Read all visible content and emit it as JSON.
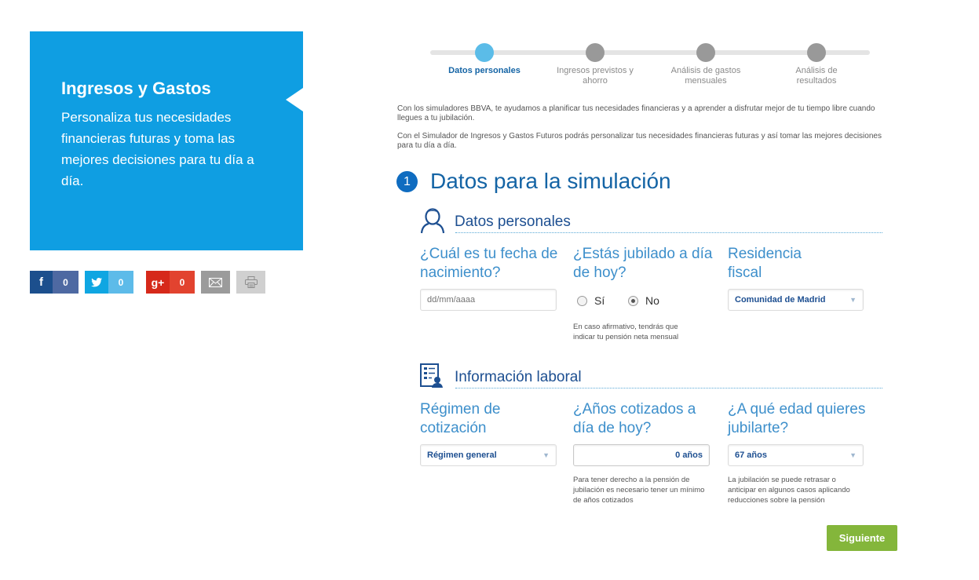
{
  "promo": {
    "title": "Ingresos y Gastos",
    "text": "Personaliza tus necesidades financieras futuras y toma las mejores decisiones para tu día a día."
  },
  "share": {
    "facebook": {
      "icon": "facebook-icon",
      "count": "0",
      "glyph": "f"
    },
    "twitter": {
      "icon": "twitter-icon",
      "count": "0",
      "glyph": "t"
    },
    "googleplus": {
      "icon": "google-plus-icon",
      "count": "0",
      "glyph": "g+"
    },
    "email": {
      "icon": "email-icon"
    },
    "print": {
      "icon": "print-icon"
    }
  },
  "stepper": {
    "current": 1,
    "steps": [
      {
        "label": "Datos personales"
      },
      {
        "label": "Ingresos previstos y ahorro"
      },
      {
        "label": "Análisis de gastos mensuales"
      },
      {
        "label": "Análisis de resultados"
      }
    ]
  },
  "intro": {
    "p1": "Con los simuladores BBVA, te ayudamos a planificar tus necesidades financieras y a aprender a disfrutar mejor de tu tiempo libre cuando llegues a tu jubilación.",
    "p2": "Con el Simulador de Ingresos y Gastos Futuros podrás personalizar tus necesidades financieras futuras y así tomar las mejores decisiones para tu día a día."
  },
  "section": {
    "number": "1",
    "title": "Datos para la simulación"
  },
  "personal": {
    "title": "Datos personales",
    "icon": "user-icon",
    "birth": {
      "question": "¿Cuál es tu fecha de nacimiento?",
      "placeholder": "dd/mm/aaaa"
    },
    "retired": {
      "question": "¿Estás jubilado a día de hoy?",
      "options": [
        "Sí",
        "No"
      ],
      "selected": "No",
      "help": "En caso afirmativo, tendrás que indicar tu pensión neta mensual"
    },
    "residence": {
      "question": "Residencia fiscal",
      "value": "Comunidad de Madrid"
    }
  },
  "work": {
    "title": "Información laboral",
    "icon": "work-info-icon",
    "regime": {
      "question": "Régimen de cotización",
      "value": "Régimen general"
    },
    "years": {
      "question": "¿Años cotizados a día de hoy?",
      "value": "0 años",
      "help": "Para tener derecho a la pensión de jubilación es necesario tener un mínimo de años cotizados"
    },
    "age": {
      "question": "¿A qué edad quieres jubilarte?",
      "value": "67 años",
      "help": "La jubilación se puede retrasar o anticipar en algunos casos aplicando reducciones sobre la pensión"
    }
  },
  "actions": {
    "next": "Siguiente"
  },
  "colors": {
    "primary": "#0f9ee2",
    "heading": "#1464a5",
    "button": "#84b63b"
  }
}
